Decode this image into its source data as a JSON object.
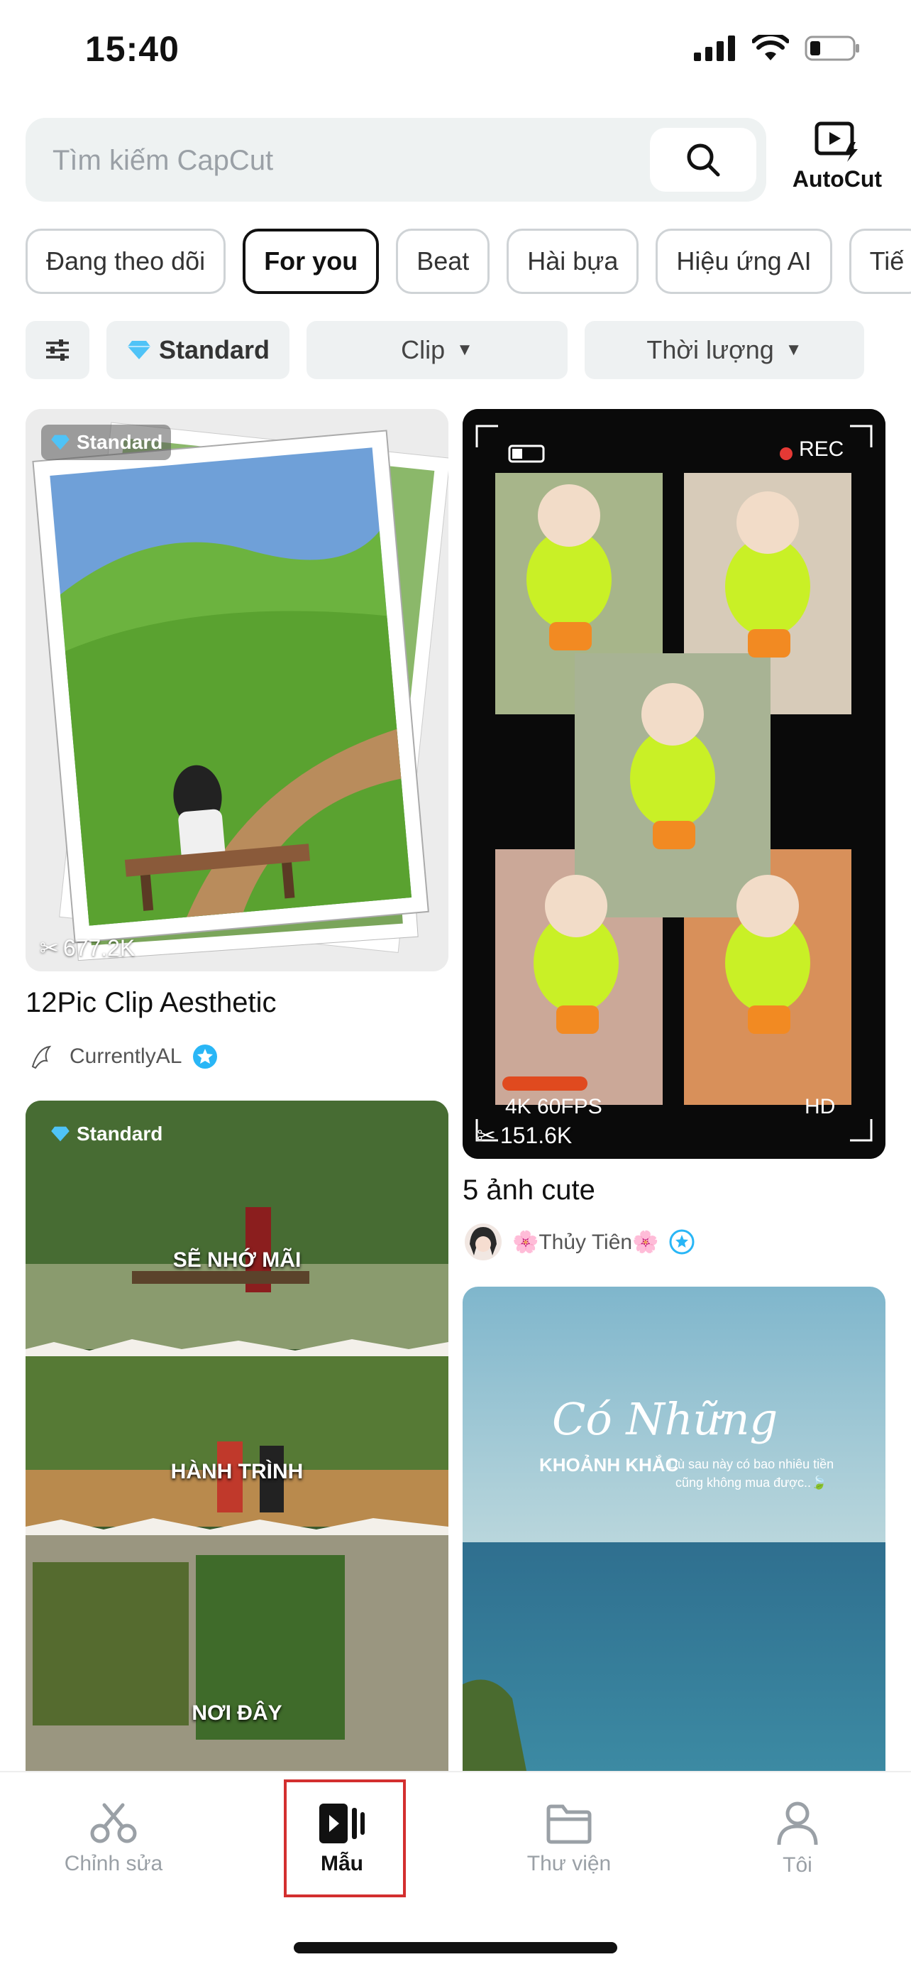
{
  "status_bar": {
    "time": "15:40"
  },
  "search": {
    "placeholder": "Tìm kiếm CapCut",
    "button_icon": "search-icon"
  },
  "autocut": {
    "label": "AutoCut",
    "icon": "autocut-icon"
  },
  "tabs": [
    {
      "label": "Đang theo dõi"
    },
    {
      "label": "For you",
      "active": true
    },
    {
      "label": "Beat"
    },
    {
      "label": "Hài bựa"
    },
    {
      "label": "Hiệu ứng AI"
    },
    {
      "label": "Tiế"
    }
  ],
  "filters": {
    "settings_icon": "sliders-icon",
    "standard_label": "Standard",
    "clip_label": "Clip",
    "duration_label": "Thời lượng"
  },
  "cards": [
    {
      "badge": "Standard",
      "views": "677.2K",
      "title": "12Pic Clip Aesthetic",
      "author": "CurrentlyAL"
    },
    {
      "views": "151.6K",
      "title": "5 ảnh cute",
      "author": "🌸Thủy Tiên🌸",
      "overlay": {
        "rec": "REC",
        "fps": "4K 60FPS",
        "hd": "HD"
      }
    },
    {
      "badge": "Standard",
      "lines": [
        "SẼ NHỚ MÃI",
        "HÀNH TRÌNH",
        "NƠI ĐÂY"
      ]
    },
    {
      "script_title": "Có Những",
      "subtitle": "KHOẢNH KHẮC",
      "caption_1": "Dù sau này có bao nhiêu tiền",
      "caption_2": "cũng không mua được..🍃"
    }
  ],
  "bottom_nav": [
    {
      "label": "Chỉnh sửa",
      "icon": "scissors-icon"
    },
    {
      "label": "Mẫu",
      "icon": "template-icon",
      "active": true
    },
    {
      "label": "Thư viện",
      "icon": "folder-icon"
    },
    {
      "label": "Tôi",
      "icon": "person-icon"
    }
  ],
  "colors": {
    "accent_diamond": "#4fc3f7",
    "verified": "#29b6f6",
    "rec_dot": "#e53935",
    "highlight_box": "#d32f2f"
  }
}
